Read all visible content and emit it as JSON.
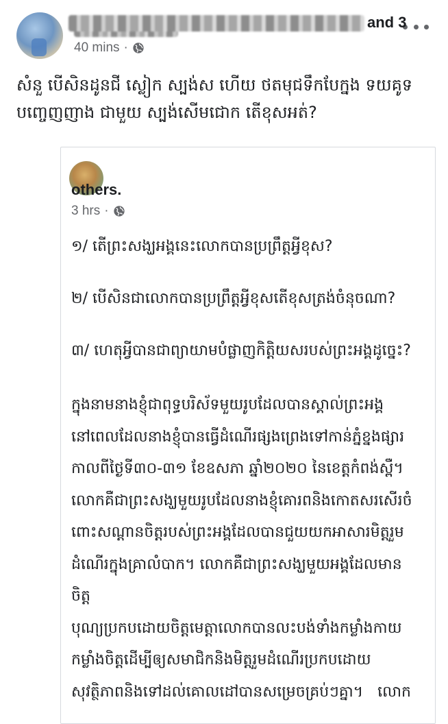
{
  "post": {
    "time": "40 mins",
    "separator": "·",
    "privacy_icon": "globe-icon",
    "more_icon": "more-horizontal-icon",
    "text": "សំនួ បើសិនដូនជី ស្លៀក ស្បង់ស ហើយ ថតមុជទឹកបែក្នង ទយគូទ\nបញ្ចេញញាង ជាមួយ ស្បង់សើមជោក តើខុសអត់?"
  },
  "shared_post": {
    "and_others_part1": "and 3",
    "and_others_part2": "others.",
    "time": "3 hrs",
    "separator": "·",
    "privacy_icon": "globe-icon",
    "questions": [
      "១/ តើព្រះសង្ឃអង្គនេះលោកបានប្រព្រឹត្តអ្វីខុស?",
      "២/ បើសិនជាលោកបានប្រព្រឹត្តអ្វីខុសតើខុសត្រង់ចំនុចណា?",
      "៣/ ហេតុអ្វីបានជាព្យាយាមបំផ្លាញកិត្តិយសរបស់ព្រះអង្គដូច្នេះ?"
    ],
    "paragraph": "ក្នុងនាមនាងខ្ញុំជាពុទ្ធបរិស័ទមួយរូបដែលបានស្គាល់ព្រះអង្គ\nនៅពេលដែលនាងខ្ញុំបានធ្វើដំណើរផ្សងព្រេងទៅកាន់ភ្នំខ្នងផ្សារ\nកាលពីថ្ងៃទី៣០-៣១ ខែឧសភា ឆ្នាំ២០២០ នៃខេត្តកំពង់ស្ពឺ។\nលោកគឺជាព្រះសង្ឃមួយរូបដែលនាងខ្ញុំគោរពនិងកោតសរសើរចំ\nពោះសណ្ដានចិត្តរបស់ព្រះអង្គដែលបានជួយយកអាសារមិត្តរួម\nដំណើរក្នុងគ្រាលំបាក។ លោកគឺជាព្រះសង្ឃមួយអង្គដែលមានចិត្ត\nបុណ្យប្រកបដោយចិត្តមេត្តាលោកបានលះបង់ទាំងកម្លាំងកាយ\nកម្លាំងចិត្តដើម្បីឲ្យសមាជិកនិងមិត្តរួមដំណើរប្រកបដោយ\nសុវត្ថិភាពនិងទៅដល់គោលដៅបានសម្រេចគ្រប់ៗគ្នា។   លោក"
  }
}
